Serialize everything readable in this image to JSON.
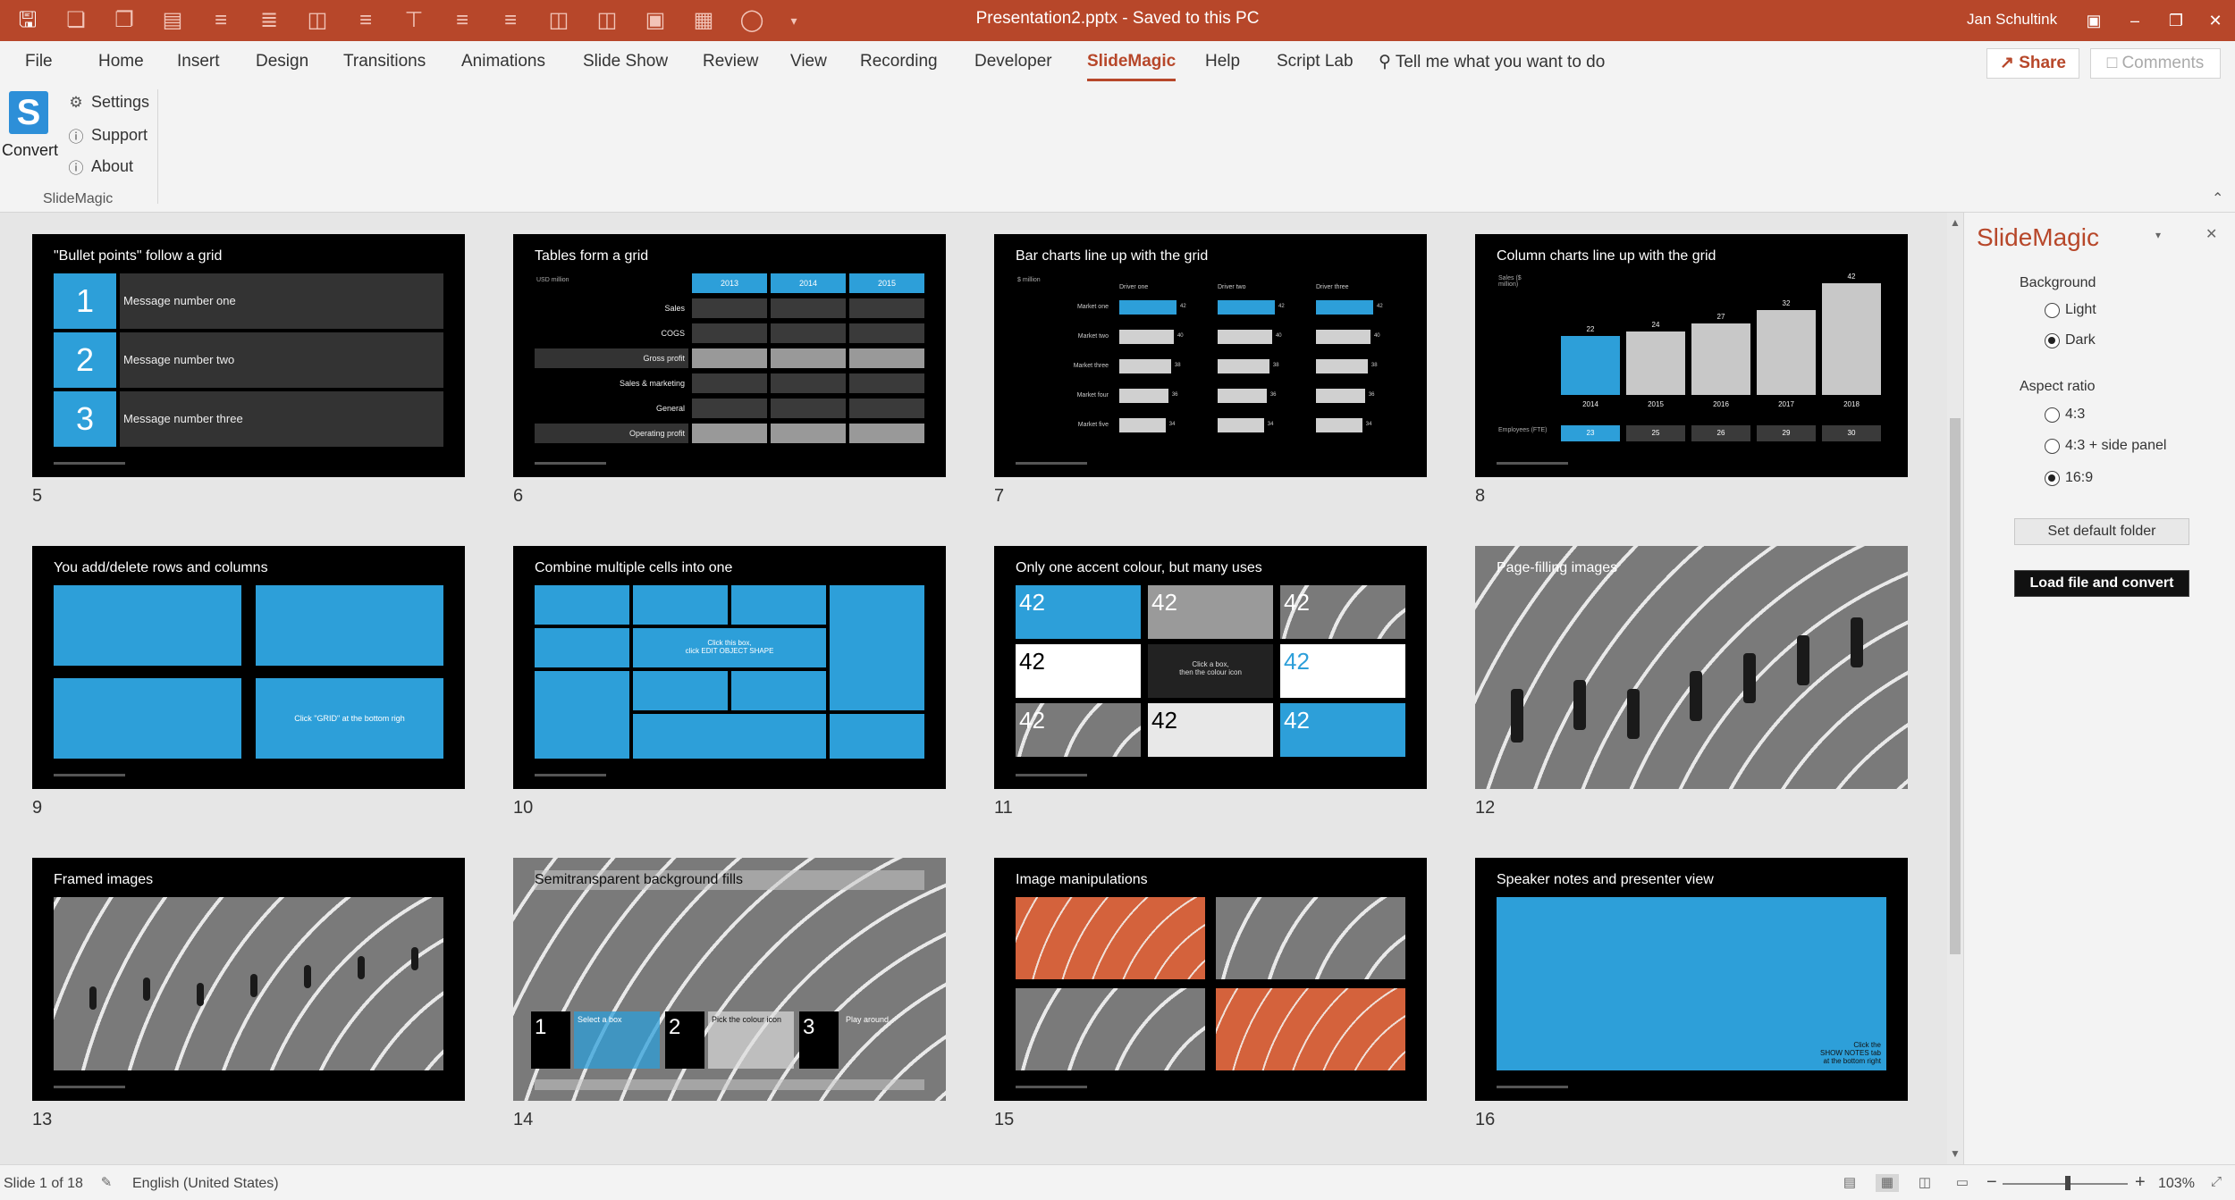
{
  "titlebar": {
    "document_title": "Presentation2.pptx  -  Saved to this PC",
    "user": "Jan Schultink"
  },
  "tabs": [
    "File",
    "Home",
    "Insert",
    "Design",
    "Transitions",
    "Animations",
    "Slide Show",
    "Review",
    "View",
    "Recording",
    "Developer",
    "SlideMagic",
    "Help",
    "Script Lab"
  ],
  "active_tab": "SlideMagic",
  "tell_me": "Tell me what you want to do",
  "share": "Share",
  "comments": "Comments",
  "ribbon": {
    "convert": "Convert",
    "convert_logo": "S",
    "settings": "Settings",
    "support": "Support",
    "about": "About",
    "group": "SlideMagic"
  },
  "slides": [
    {
      "num": "5",
      "title": "\"Bullet points\" follow a grid",
      "bullets": [
        {
          "n": "1",
          "text": "Message number one"
        },
        {
          "n": "2",
          "text": "Message number two"
        },
        {
          "n": "3",
          "text": "Message number three"
        }
      ]
    },
    {
      "num": "6",
      "title": "Tables form a grid",
      "unit": "USD million",
      "years": [
        "2013",
        "2014",
        "2015"
      ],
      "rows": [
        "Sales",
        "COGS",
        "Gross profit",
        "Sales & marketing",
        "General",
        "Operating profit"
      ]
    },
    {
      "num": "7",
      "title": "Bar charts line up with the grid",
      "unit": "$ million",
      "drivers": [
        "Driver one",
        "Driver two",
        "Driver three"
      ],
      "markets": [
        "Market one",
        "Market two",
        "Market three",
        "Market four",
        "Market five"
      ],
      "values": [
        "42",
        "40",
        "38",
        "36",
        "34"
      ]
    },
    {
      "num": "8",
      "title": "Column charts line up with the grid",
      "ylabel": "Sales ($ million)",
      "row_label": "Employees (FTE)",
      "chart": {
        "type": "bar",
        "categories": [
          "2014",
          "2015",
          "2016",
          "2017",
          "2018"
        ],
        "values": [
          22,
          24,
          27,
          32,
          42
        ],
        "ylim": [
          0,
          45
        ]
      },
      "employees": [
        "23",
        "25",
        "26",
        "29",
        "30"
      ]
    },
    {
      "num": "9",
      "title": "You add/delete rows and columns",
      "cell_text": "Click \"GRID\" at the bottom righ"
    },
    {
      "num": "10",
      "title": "Combine multiple cells into one",
      "cell_text_1": "Click this box,",
      "cell_text_2": "click EDIT OBJECT SHAPE"
    },
    {
      "num": "11",
      "title": "Only one accent colour, but many uses",
      "value": "42",
      "cell_text_1": "Click a box,",
      "cell_text_2": "then the colour icon"
    },
    {
      "num": "12",
      "title": "Page-filling images"
    },
    {
      "num": "13",
      "title": "Framed images"
    },
    {
      "num": "14",
      "title": "Semitransparent background fills",
      "steps": [
        {
          "n": "1",
          "text": "Select a box"
        },
        {
          "n": "2",
          "text": "Pick the colour icon"
        },
        {
          "n": "3",
          "text": "Play around"
        }
      ]
    },
    {
      "num": "15",
      "title": "Image manipulations"
    },
    {
      "num": "16",
      "title": "Speaker notes and presenter view",
      "note_1": "Click the",
      "note_2": "SHOW NOTES tab",
      "note_3": "at the bottom right"
    }
  ],
  "taskpane": {
    "title": "SlideMagic",
    "background_heading": "Background",
    "background_options": [
      "Light",
      "Dark"
    ],
    "background_selected": "Dark",
    "aspect_heading": "Aspect ratio",
    "aspect_options": [
      "4:3",
      "4:3 + side panel",
      "16:9"
    ],
    "aspect_selected": "16:9",
    "set_folder": "Set default folder",
    "load_convert": "Load file and convert"
  },
  "statusbar": {
    "slide_info": "Slide 1 of 18",
    "language": "English (United States)",
    "zoom_minus": "−",
    "zoom_plus": "+",
    "zoom": "103%"
  },
  "colors": {
    "accent": "#b7472a",
    "slide_blue": "#2d9fd9"
  }
}
